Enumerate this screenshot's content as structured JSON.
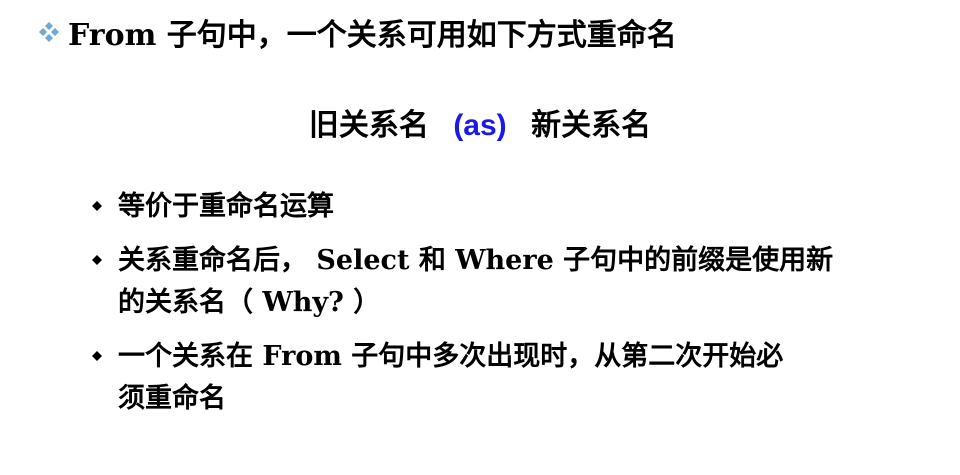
{
  "heading": {
    "text": "From 子句中，一个关系可用如下方式重命名",
    "bullet_icon": "four-diamond-bullet-icon",
    "bullet_color": "#6ea8d8"
  },
  "syntax": {
    "old_name": "旧关系名",
    "keyword": "(as)",
    "new_name": "新关系名",
    "keyword_color": "#1a1ae6"
  },
  "bullets": [
    {
      "lines": [
        "等价于重命名运算"
      ]
    },
    {
      "lines": [
        "关系重命名后， Select 和 Where 子句中的前缀是使用新",
        "的关系名（ Why? ）"
      ]
    },
    {
      "lines": [
        "一个关系在 From 子句中多次出现时，从第二次开始必",
        "须重命名"
      ]
    }
  ],
  "bullet_icon": "diamond-bullet-icon"
}
